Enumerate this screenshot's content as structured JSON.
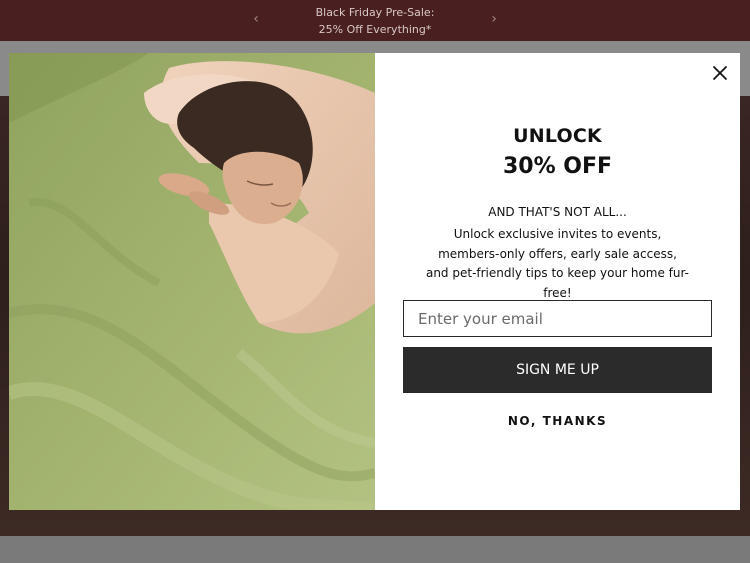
{
  "announcement": {
    "line1": "Black Friday Pre-Sale:",
    "line2": "25% Off Everything*",
    "prev_icon": "chevron-left-icon",
    "next_icon": "chevron-right-icon"
  },
  "popup": {
    "close_icon": "close-icon",
    "eyebrow": "UNLOCK",
    "headline": "30% OFF",
    "subhead": "AND THAT'S NOT ALL...",
    "body": "Unlock exclusive invites to events, members-only offers, early sale access, and pet-friendly tips to keep your home fur-free!",
    "email_placeholder": "Enter your email",
    "email_value": "",
    "signup_label": "SIGN ME UP",
    "decline_label": "NO, THANKS"
  },
  "colors": {
    "announcement_bg": "#4a1f1f",
    "button_bg": "#2b2b2b",
    "sheet_green": "#a3b36f"
  }
}
